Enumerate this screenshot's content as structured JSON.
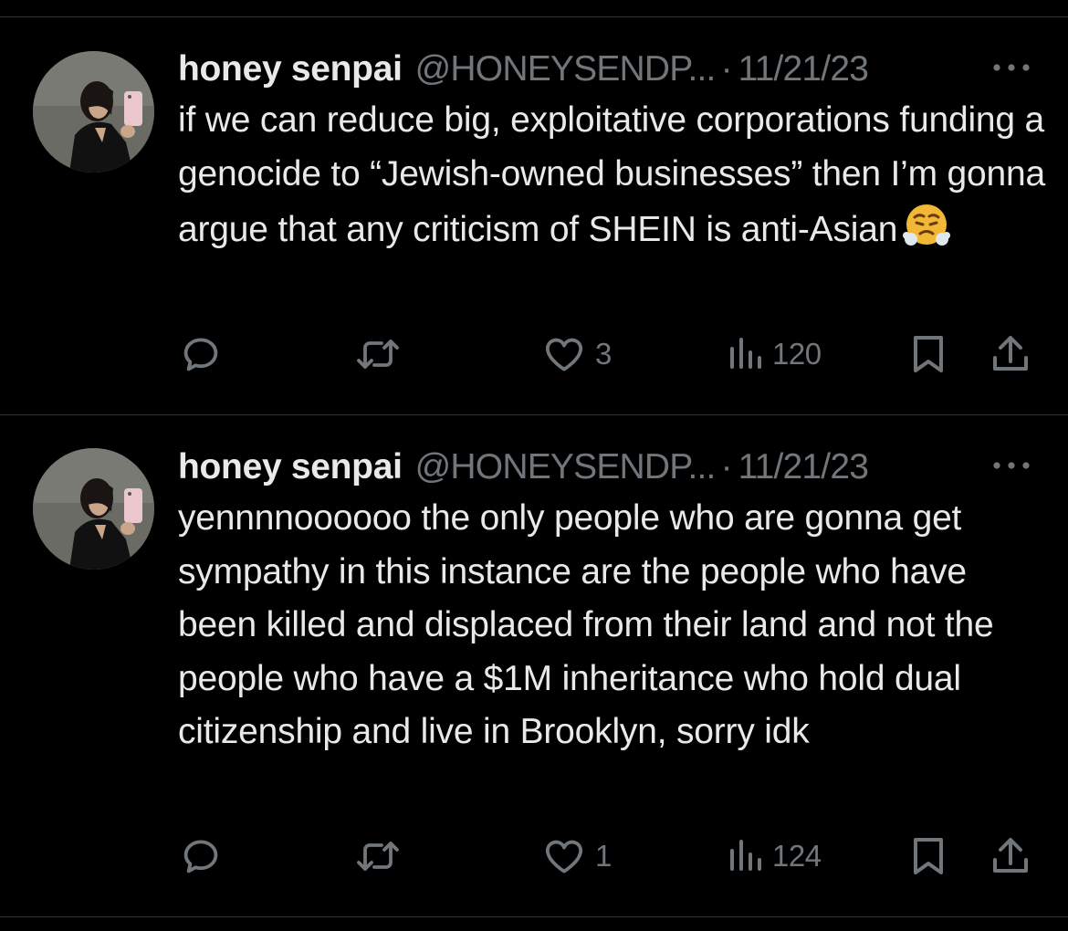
{
  "colors": {
    "background": "#000000",
    "primary_text": "#e7e9ea",
    "secondary_text": "#71767b",
    "divider": "#2f3336"
  },
  "tweets": [
    {
      "author_name": "honey senpai",
      "handle": "@HONEYSENDP...",
      "separator": "·",
      "date": "11/21/23",
      "text": "if we can reduce big, exploitative corporations funding a genocide to “Jewish-owned businesses” then I’m gonna argue that any criticism of SHEIN is anti-Asian",
      "emoji": "face-with-steam-from-nose",
      "likes": "3",
      "views": "120"
    },
    {
      "author_name": "honey senpai",
      "handle": "@HONEYSENDP...",
      "separator": "·",
      "date": "11/21/23",
      "text": "yennnnoooooo the only people who are gonna get sympathy in this instance are the people who have been killed and displaced from their land and not the people who have a $1M inheritance who hold dual citizenship and live in Brooklyn, sorry idk",
      "likes": "1",
      "views": "124"
    }
  ]
}
